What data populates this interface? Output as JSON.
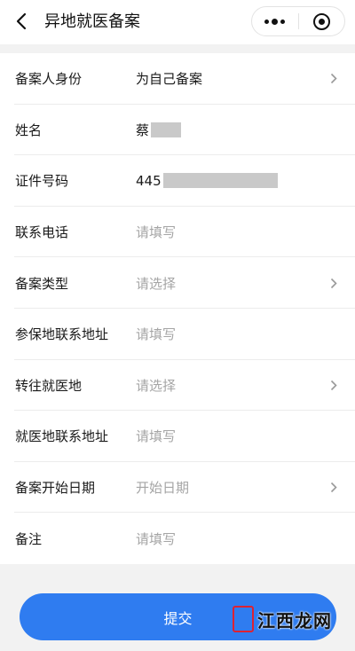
{
  "nav": {
    "title": "异地就医备案",
    "back_icon": "chevron-left-icon",
    "more_icon": "more-dots-icon",
    "close_icon": "target-icon"
  },
  "form": {
    "rows": [
      {
        "label": "备案人身份",
        "value": "为自己备案",
        "placeholder": false,
        "chevron": true
      },
      {
        "label": "姓名",
        "value": "蔡",
        "placeholder": false,
        "chevron": false,
        "masked": true
      },
      {
        "label": "证件号码",
        "value": "445",
        "placeholder": false,
        "chevron": false,
        "masked": true
      },
      {
        "label": "联系电话",
        "value": "请填写",
        "placeholder": true,
        "chevron": false
      },
      {
        "label": "备案类型",
        "value": "请选择",
        "placeholder": true,
        "chevron": true
      },
      {
        "label": "参保地联系地址",
        "value": "请填写",
        "placeholder": true,
        "chevron": false
      },
      {
        "label": "转往就医地",
        "value": "请选择",
        "placeholder": true,
        "chevron": true
      },
      {
        "label": "就医地联系地址",
        "value": "请填写",
        "placeholder": true,
        "chevron": false
      },
      {
        "label": "备案开始日期",
        "value": "开始日期",
        "placeholder": true,
        "chevron": true
      },
      {
        "label": "备注",
        "value": "请填写",
        "placeholder": true,
        "chevron": false
      }
    ]
  },
  "submit": {
    "label": "提交"
  },
  "watermark": {
    "text": "江西龙网"
  },
  "colors": {
    "accent": "#2f7cf0",
    "placeholder": "#a5a5a5"
  }
}
